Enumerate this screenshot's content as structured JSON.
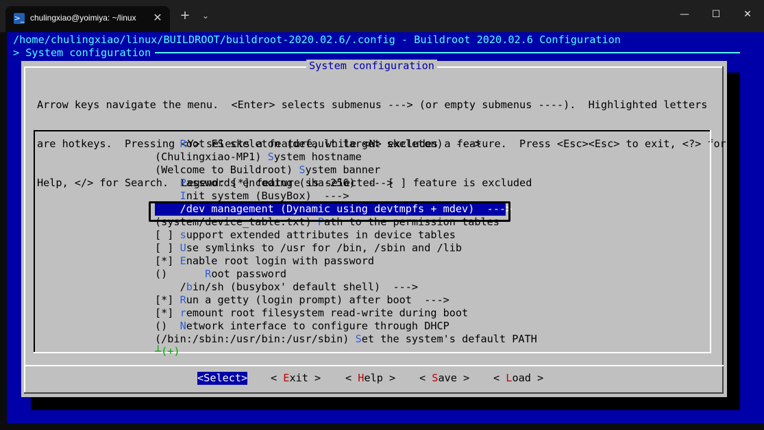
{
  "window": {
    "tab_title": "chulingxiao@yoimiya: ~/linux",
    "icons": [
      "powershell-icon",
      "close-icon",
      "plus-icon",
      "chevron-down-icon",
      "minimize-icon",
      "maximize-icon",
      "close-window-icon"
    ],
    "tab_close": "✕",
    "new_tab": "+",
    "dropdown": "⌄",
    "minimize": "—",
    "maximize": "☐",
    "close": "✕"
  },
  "terminal": {
    "header": "/home/chulingxiao/linux/BUILDROOT/buildroot-2020.02.6/.config - Buildroot 2020.02.6 Configuration",
    "breadcrumb": "> System configuration",
    "colors": {
      "background": "#0000a8",
      "dialog": "#c0c0c0",
      "accent": "#55ffff",
      "hotkey": "#2e5fd3",
      "button_hotkey": "#c00000"
    }
  },
  "dialog": {
    "title": "System configuration",
    "help_lines": [
      "Arrow keys navigate the menu.  <Enter> selects submenus ---> (or empty submenus ----).  Highlighted letters",
      "are hotkeys.  Pressing <Y> selects a feature, while <N> excludes a feature.  Press <Esc><Esc> to exit, <?> for",
      "Help, </> for Search.  Legend: [*] feature is selected  [ ] feature is excluded"
    ]
  },
  "menu": {
    "items": [
      {
        "pre": "    ",
        "hk": "R",
        "post": "oot FS skeleton (default target skeleton)  --->"
      },
      {
        "pre": "(Chulingxiao-MP1) ",
        "hk": "S",
        "post": "ystem hostname"
      },
      {
        "pre": "(Welcome to Buildroot) ",
        "hk": "S",
        "post": "ystem banner"
      },
      {
        "pre": "    ",
        "hk": "P",
        "post": "asswords encoding (sha-256)  --->"
      },
      {
        "pre": "    ",
        "hk": "I",
        "post": "nit system (BusyBox)  --->"
      },
      {
        "pre": "    ",
        "hk": "/",
        "post": "dev management (Dynamic using devtmpfs + mdev)  --->"
      },
      {
        "pre": "(system/device_table.txt) ",
        "hk": "P",
        "post": "ath to the permission tables"
      },
      {
        "pre": "[ ] ",
        "hk": "s",
        "post": "upport extended attributes in device tables"
      },
      {
        "pre": "[ ] ",
        "hk": "U",
        "post": "se symlinks to /usr for /bin, /sbin and /lib"
      },
      {
        "pre": "[*] ",
        "hk": "E",
        "post": "nable root login with password"
      },
      {
        "pre": "()      ",
        "hk": "R",
        "post": "oot password"
      },
      {
        "pre": "    /",
        "hk": "b",
        "post": "in/sh (busybox' default shell)  --->"
      },
      {
        "pre": "[*] ",
        "hk": "R",
        "post": "un a getty (login prompt) after boot  --->"
      },
      {
        "pre": "[*] ",
        "hk": "r",
        "post": "emount root filesystem read-write during boot"
      },
      {
        "pre": "()  ",
        "hk": "N",
        "post": "etwork interface to configure through DHCP"
      },
      {
        "pre": "(/bin:/sbin:/usr/bin:/usr/sbin) ",
        "hk": "S",
        "post": "et the system's default PATH"
      }
    ],
    "selected_index": 5,
    "more_indicator": "┴(+)"
  },
  "buttons": [
    {
      "pre": "<",
      "hk": "S",
      "post": "elect>"
    },
    {
      "pre": "< ",
      "hk": "E",
      "post": "xit >"
    },
    {
      "pre": "< ",
      "hk": "H",
      "post": "elp >"
    },
    {
      "pre": "< ",
      "hk": "S",
      "post": "ave >"
    },
    {
      "pre": "< ",
      "hk": "L",
      "post": "oad >"
    }
  ]
}
